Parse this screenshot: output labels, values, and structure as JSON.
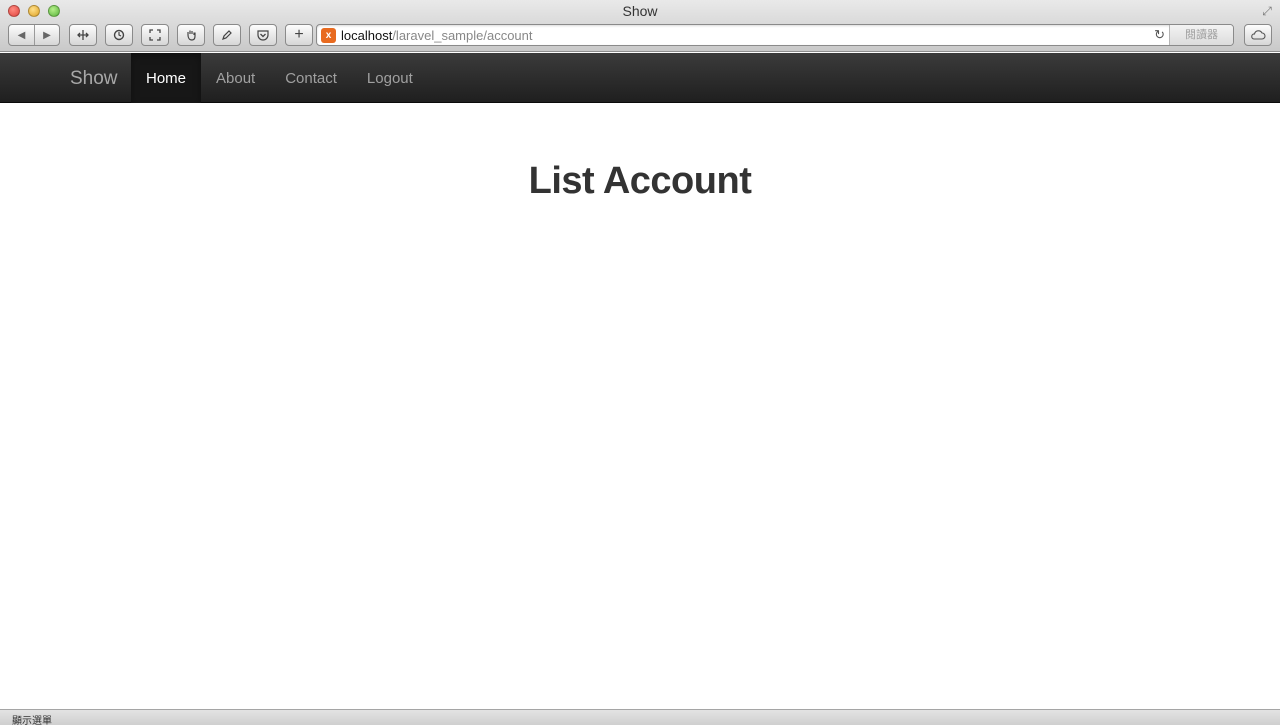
{
  "window": {
    "title": "Show"
  },
  "browser": {
    "url_host": "localhost",
    "url_path": "/laravel_sample/account",
    "reader_label": "閱讀器",
    "status_text": "顯示選單"
  },
  "navbar": {
    "brand": "Show",
    "links": [
      {
        "label": "Home",
        "active": true
      },
      {
        "label": "About",
        "active": false
      },
      {
        "label": "Contact",
        "active": false
      },
      {
        "label": "Logout",
        "active": false
      }
    ]
  },
  "main": {
    "title": "List Account"
  },
  "colors": {
    "navbar_bg": "#2a2a2a",
    "navbar_active": "#171717",
    "link": "#a0a0a0",
    "title": "#333333",
    "favicon": "#e86a1f"
  }
}
